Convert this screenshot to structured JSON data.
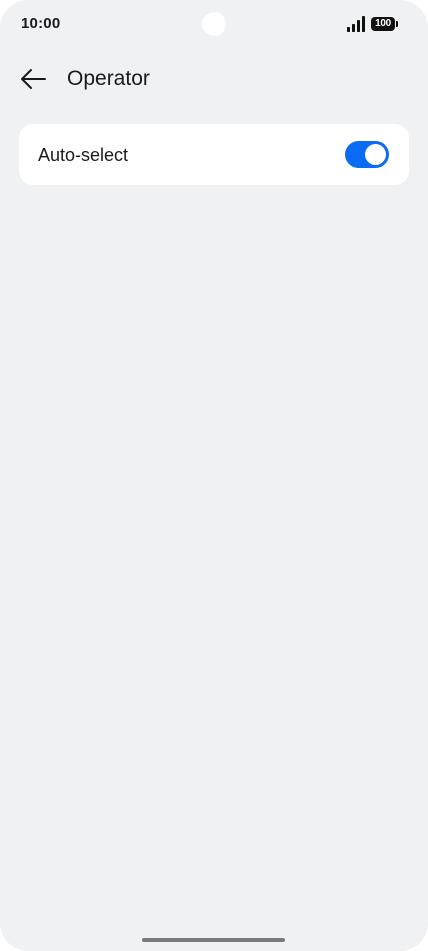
{
  "status_bar": {
    "time": "10:00",
    "battery_level": "100",
    "signal_icon": "signal-bars-icon"
  },
  "header": {
    "back_icon": "arrow-left-icon",
    "title": "Operator"
  },
  "settings": {
    "auto_select": {
      "label": "Auto-select",
      "enabled": true,
      "accent_color": "#0a6cf5"
    }
  }
}
